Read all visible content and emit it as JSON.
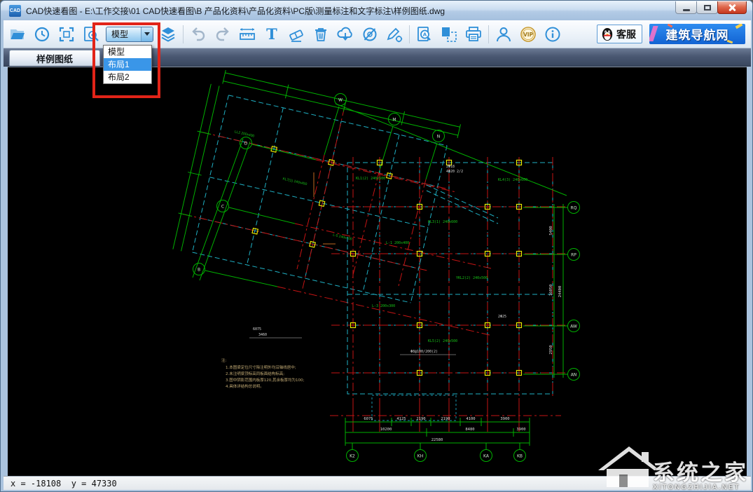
{
  "window": {
    "title": "CAD快速看图 - E:\\工作交接\\01 CAD快速看图\\B 产品化资料\\产品化资料\\PC版\\测量标注和文字标注\\样例图纸.dwg"
  },
  "toolbar": {
    "icons": [
      "open-file",
      "history",
      "fit-extent",
      "view-zoom",
      "layout-select",
      "layers",
      "undo",
      "redo",
      "measure",
      "text-annotate",
      "eraser",
      "delete",
      "cloud-sync",
      "hide-layer",
      "annotation-settings",
      "find-text",
      "page-copy",
      "print",
      "account",
      "vip",
      "about"
    ],
    "layout_select": {
      "value": "模型",
      "options": [
        "模型",
        "布局1",
        "布局2"
      ],
      "highlighted": "布局1"
    },
    "service_label": "客服",
    "vip_label": "VIP",
    "banner_label": "建筑导航网"
  },
  "tabs": [
    {
      "label": "样例图纸",
      "active": true
    }
  ],
  "statusbar": {
    "coords": "x = -18108  y = 47330"
  },
  "watermark": {
    "name": "系统之家",
    "domain": "XITONGZHIJIA.NET"
  },
  "drawing": {
    "bubbles_top": [
      "W",
      "M",
      "N"
    ],
    "bubbles_left": [
      "D",
      "C",
      "B"
    ],
    "bubbles_right": [
      "RQ",
      "RP",
      "AW",
      "AN"
    ],
    "bubbles_bottom": [
      "K2",
      "KH",
      "KA",
      "KB"
    ],
    "bottom_dims": [
      "6075",
      "4125",
      "2190",
      "2190",
      "4100",
      "3900"
    ],
    "bottom_dims2": [
      "10200",
      "8480",
      "3900"
    ],
    "bottom_total": "22580",
    "right_dims": [
      "5400",
      "16050",
      "2950"
    ],
    "right_total": "24400",
    "green_labels": [
      "KL1(2) 240x500",
      "L-1 200x400",
      "KL3(1) 240x600",
      "YKL2(2) 240x500",
      "L-3 200x300",
      "KL5(2) 240x500",
      "LL2 200x400",
      "KL7(1) 240x450",
      "L-5 240x400",
      "KL4(3) 240x600"
    ],
    "white_labels": [
      "2Φ18",
      "4Φ20 2/2",
      "Φ8@100/200(2)",
      "2Φ25",
      "6075",
      "3460"
    ],
    "notes": [
      "注:",
      "1.本图梁定位尺寸除注明外均沿轴线居中;",
      "2.未注明梁顶标高同板面结构标高;",
      "3.图中阴影范围内板厚120,其余板厚均为100;",
      "4.具体详结构总说明。"
    ]
  }
}
